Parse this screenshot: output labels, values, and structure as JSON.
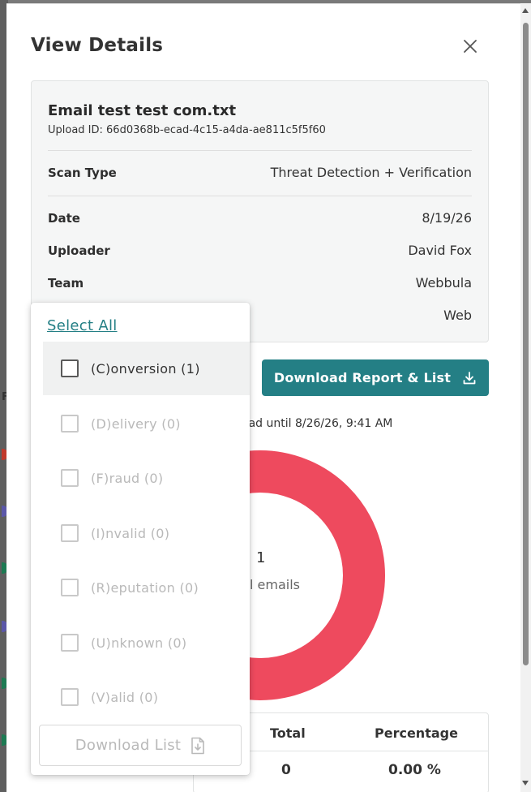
{
  "modal": {
    "title": "View Details"
  },
  "file": {
    "name": "Email test test com.txt",
    "upload_id": "Upload ID: 66d0368b-ecad-4c15-a4da-ae811c5f5f60"
  },
  "details": [
    {
      "label": "Scan Type",
      "value": "Threat Detection + Verification"
    },
    {
      "label": "Date",
      "value": "8/19/26"
    },
    {
      "label": "Uploader",
      "value": "David Fox"
    },
    {
      "label": "Team",
      "value": "Webbula"
    },
    {
      "label": "",
      "value": "Web"
    }
  ],
  "actions": {
    "download_report_label": "Download Report & List",
    "availability_text": "oad until 8/26/26, 9:41 AM"
  },
  "donut": {
    "total": "1",
    "label": "l emails",
    "color": "#ee4a5e"
  },
  "table": {
    "headers": [
      "Total",
      "Percentage"
    ],
    "row": [
      "0",
      "0.00 %"
    ]
  },
  "dropdown": {
    "select_all": "Select All",
    "options": [
      {
        "label": "(C)onversion (1)",
        "enabled": true
      },
      {
        "label": "(D)elivery (0)",
        "enabled": false
      },
      {
        "label": "(F)raud (0)",
        "enabled": false
      },
      {
        "label": "(I)nvalid (0)",
        "enabled": false
      },
      {
        "label": "(R)eputation (0)",
        "enabled": false
      },
      {
        "label": "(U)nknown (0)",
        "enabled": false
      },
      {
        "label": "(V)alid (0)",
        "enabled": false
      }
    ],
    "download_list_label": "Download List"
  },
  "background": {
    "letter": "F"
  },
  "colors": {
    "accent": "#247f85",
    "donut": "#ee4a5e"
  }
}
